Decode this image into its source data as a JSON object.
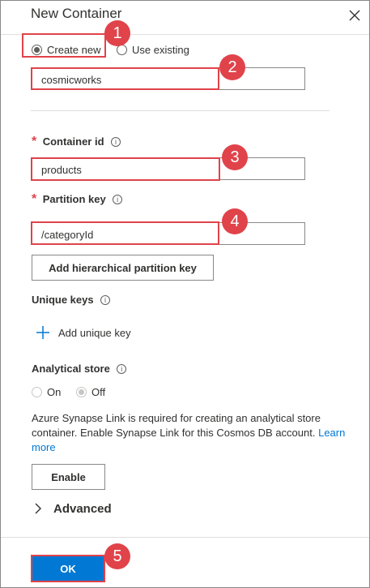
{
  "dialog": {
    "title": "New Container",
    "close_icon": "close-icon"
  },
  "database": {
    "create_new_label": "Create new",
    "use_existing_label": "Use existing",
    "selected": "Create new",
    "name_value": "cosmicworks"
  },
  "container_id": {
    "label": "Container id",
    "required_mark": "*",
    "value": "products"
  },
  "partition_key": {
    "label": "Partition key",
    "required_mark": "*",
    "value": "/categoryId",
    "hierarchical_button": "Add hierarchical partition key"
  },
  "unique_keys": {
    "label": "Unique keys",
    "add_label": "Add unique key"
  },
  "analytical_store": {
    "label": "Analytical store",
    "on_label": "On",
    "off_label": "Off",
    "selected": "Off",
    "note_text": "Azure Synapse Link is required for creating an analytical store container. Enable Synapse Link for this Cosmos DB account.",
    "learn_more": "Learn more",
    "enable_button": "Enable"
  },
  "advanced": {
    "label": "Advanced"
  },
  "footer": {
    "ok_label": "OK"
  },
  "annotations": {
    "badge_1": "1",
    "badge_2": "2",
    "badge_3": "3",
    "badge_4": "4",
    "badge_5": "5",
    "highlight_color": "#e0434a"
  },
  "colors": {
    "accent": "#0078d4",
    "required": "#e0434a"
  }
}
